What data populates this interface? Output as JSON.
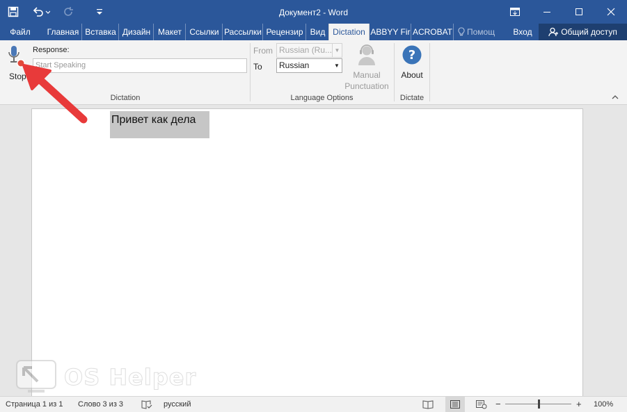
{
  "window": {
    "title": "Документ2 - Word"
  },
  "quick_access": {
    "icons": [
      "save-icon",
      "undo-icon",
      "redo-icon",
      "customize-qat-icon"
    ]
  },
  "tabs": [
    {
      "label": "Файл"
    },
    {
      "label": "Главная"
    },
    {
      "label": "Вставка"
    },
    {
      "label": "Дизайн"
    },
    {
      "label": "Макет"
    },
    {
      "label": "Ссылки"
    },
    {
      "label": "Рассылки"
    },
    {
      "label": "Рецензир"
    },
    {
      "label": "Вид"
    },
    {
      "label": "Dictation",
      "active": true
    },
    {
      "label": "ABBYY Fir"
    },
    {
      "label": "ACROBAT"
    }
  ],
  "tell_me": "Помощ",
  "sign_in": "Вход",
  "share": "Общий доступ",
  "ribbon": {
    "dictation": {
      "stop_label": "Stop",
      "response_label": "Response:",
      "response_placeholder": "Start Speaking",
      "group_label": "Dictation"
    },
    "language": {
      "from_label": "From",
      "from_value": "Russian (Ru...",
      "to_label": "To",
      "to_value": "Russian",
      "manual_punct_line1": "Manual",
      "manual_punct_line2": "Punctuation",
      "group_label": "Language Options"
    },
    "dictate": {
      "about_label": "About",
      "group_label": "Dictate"
    }
  },
  "document": {
    "text": "Привет как дела"
  },
  "watermark": {
    "text": "OS Helper"
  },
  "statusbar": {
    "page": "Страница 1 из 1",
    "words": "Слово 3 из 3",
    "language": "русский",
    "zoom": "100%",
    "zoom_minus": "−",
    "zoom_plus": "+"
  },
  "colors": {
    "accent": "#2b579a",
    "arrow": "#e83a3a"
  }
}
